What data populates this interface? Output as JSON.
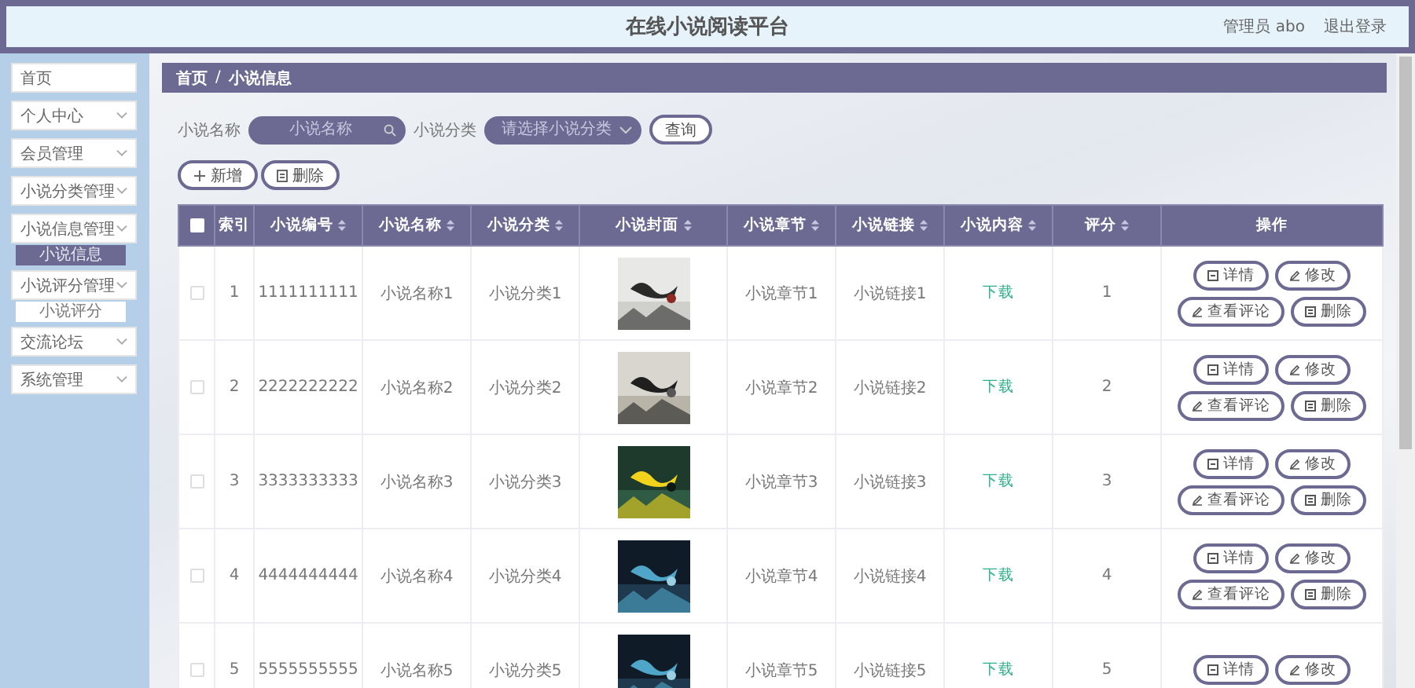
{
  "header": {
    "title": "在线小说阅读平台",
    "user": "管理员 abo",
    "logout": "退出登录"
  },
  "sidebar": {
    "items": [
      {
        "label": "首页",
        "expandable": false
      },
      {
        "label": "个人中心",
        "expandable": true
      },
      {
        "label": "会员管理",
        "expandable": true
      },
      {
        "label": "小说分类管理",
        "expandable": true
      },
      {
        "label": "小说信息管理",
        "expandable": true,
        "children": [
          {
            "label": "小说信息",
            "selected": true
          }
        ]
      },
      {
        "label": "小说评分管理",
        "expandable": true,
        "children": [
          {
            "label": "小说评分",
            "selected": false
          }
        ]
      },
      {
        "label": "交流论坛",
        "expandable": true
      },
      {
        "label": "系统管理",
        "expandable": true
      }
    ]
  },
  "breadcrumb": {
    "items": [
      "首页",
      "小说信息"
    ],
    "separator": "/"
  },
  "search": {
    "fields": [
      {
        "label": "小说名称",
        "placeholder": "小说名称",
        "kind": "text"
      },
      {
        "label": "小说分类",
        "placeholder": "请选择小说分类",
        "kind": "select"
      }
    ],
    "button": "查询"
  },
  "toolbar": [
    {
      "label": "新增",
      "kind": "add"
    },
    {
      "label": "删除",
      "kind": "delete"
    }
  ],
  "table": {
    "header_checked": false,
    "columns": [
      {
        "label": "索引",
        "sortable": false
      },
      {
        "label": "小说编号",
        "sortable": true
      },
      {
        "label": "小说名称",
        "sortable": true
      },
      {
        "label": "小说分类",
        "sortable": true
      },
      {
        "label": "小说封面",
        "sortable": true
      },
      {
        "label": "小说章节",
        "sortable": true
      },
      {
        "label": "小说链接",
        "sortable": true
      },
      {
        "label": "小说内容",
        "sortable": true
      },
      {
        "label": "评分",
        "sortable": true
      },
      {
        "label": "操作",
        "sortable": false
      }
    ],
    "rows": [
      {
        "checked": false,
        "index": "1",
        "code": "1111111111",
        "name": "小说名称1",
        "category": "小说分类1",
        "cover": {
          "kind": "picture"
        },
        "chapter": "小说章节1",
        "link": "小说链接1",
        "content": "下载",
        "rating": "1",
        "actions": [
          {
            "label": "详情",
            "kind": "detail"
          },
          {
            "label": "修改",
            "kind": "edit"
          },
          {
            "label": "查看评论",
            "kind": "edit"
          },
          {
            "label": "删除",
            "kind": "delete"
          }
        ]
      },
      {
        "checked": false,
        "index": "2",
        "code": "2222222222",
        "name": "小说名称2",
        "category": "小说分类2",
        "cover": {
          "kind": "picture"
        },
        "chapter": "小说章节2",
        "link": "小说链接2",
        "content": "下载",
        "rating": "2",
        "actions": [
          {
            "label": "详情",
            "kind": "detail"
          },
          {
            "label": "修改",
            "kind": "edit"
          },
          {
            "label": "查看评论",
            "kind": "edit"
          },
          {
            "label": "删除",
            "kind": "delete"
          }
        ]
      },
      {
        "checked": false,
        "index": "3",
        "code": "3333333333",
        "name": "小说名称3",
        "category": "小说分类3",
        "cover": {
          "kind": "picture"
        },
        "chapter": "小说章节3",
        "link": "小说链接3",
        "content": "下载",
        "rating": "3",
        "actions": [
          {
            "label": "详情",
            "kind": "detail"
          },
          {
            "label": "修改",
            "kind": "edit"
          },
          {
            "label": "查看评论",
            "kind": "edit"
          },
          {
            "label": "删除",
            "kind": "delete"
          }
        ]
      },
      {
        "checked": false,
        "index": "4",
        "code": "4444444444",
        "name": "小说名称4",
        "category": "小说分类4",
        "cover": {
          "kind": "picture"
        },
        "chapter": "小说章节4",
        "link": "小说链接4",
        "content": "下载",
        "rating": "4",
        "actions": [
          {
            "label": "详情",
            "kind": "detail"
          },
          {
            "label": "修改",
            "kind": "edit"
          },
          {
            "label": "查看评论",
            "kind": "edit"
          },
          {
            "label": "删除",
            "kind": "delete"
          }
        ]
      },
      {
        "checked": false,
        "index": "5",
        "code": "5555555555",
        "name": "小说名称5",
        "category": "小说分类5",
        "cover": {
          "kind": "picture"
        },
        "chapter": "小说章节5",
        "link": "小说链接5",
        "content": "下载",
        "rating": "5",
        "actions": [
          {
            "label": "详情",
            "kind": "detail"
          },
          {
            "label": "修改",
            "kind": "edit"
          }
        ]
      }
    ]
  }
}
